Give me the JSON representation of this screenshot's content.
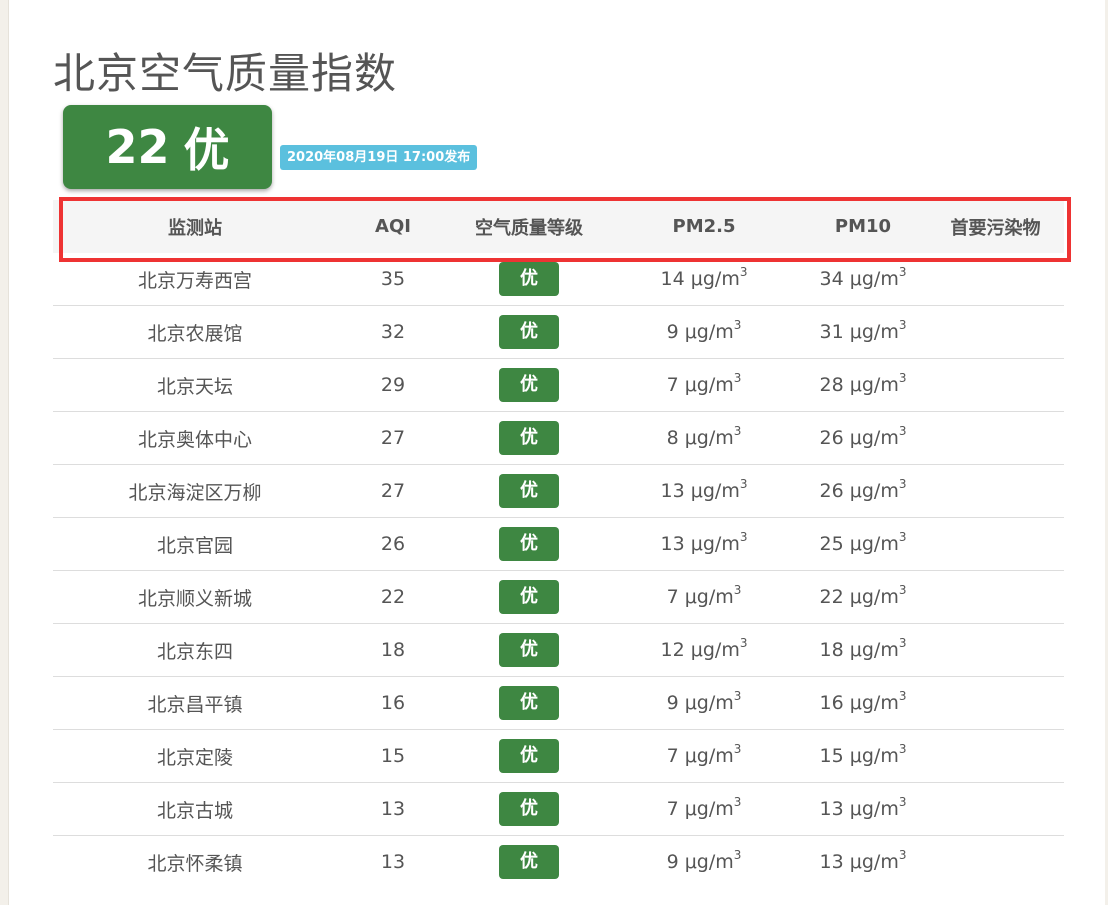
{
  "header": {
    "title": "北京空气质量指数",
    "aqi_value": "22",
    "aqi_level": "优",
    "publish_time": "2020年08月19日 17:00发布"
  },
  "table": {
    "columns": [
      "监测站",
      "AQI",
      "空气质量等级",
      "PM2.5",
      "PM10",
      "首要污染物"
    ],
    "unit_base": "μg/m",
    "unit_exp": "3",
    "rows": [
      {
        "station": "北京万寿西宫",
        "aqi": "35",
        "level": "优",
        "pm25": "14",
        "pm10": "34",
        "primary": ""
      },
      {
        "station": "北京农展馆",
        "aqi": "32",
        "level": "优",
        "pm25": "9",
        "pm10": "31",
        "primary": ""
      },
      {
        "station": "北京天坛",
        "aqi": "29",
        "level": "优",
        "pm25": "7",
        "pm10": "28",
        "primary": ""
      },
      {
        "station": "北京奥体中心",
        "aqi": "27",
        "level": "优",
        "pm25": "8",
        "pm10": "26",
        "primary": ""
      },
      {
        "station": "北京海淀区万柳",
        "aqi": "27",
        "level": "优",
        "pm25": "13",
        "pm10": "26",
        "primary": ""
      },
      {
        "station": "北京官园",
        "aqi": "26",
        "level": "优",
        "pm25": "13",
        "pm10": "25",
        "primary": ""
      },
      {
        "station": "北京顺义新城",
        "aqi": "22",
        "level": "优",
        "pm25": "7",
        "pm10": "22",
        "primary": ""
      },
      {
        "station": "北京东四",
        "aqi": "18",
        "level": "优",
        "pm25": "12",
        "pm10": "18",
        "primary": ""
      },
      {
        "station": "北京昌平镇",
        "aqi": "16",
        "level": "优",
        "pm25": "9",
        "pm10": "16",
        "primary": ""
      },
      {
        "station": "北京定陵",
        "aqi": "15",
        "level": "优",
        "pm25": "7",
        "pm10": "15",
        "primary": ""
      },
      {
        "station": "北京古城",
        "aqi": "13",
        "level": "优",
        "pm25": "7",
        "pm10": "13",
        "primary": ""
      },
      {
        "station": "北京怀柔镇",
        "aqi": "13",
        "level": "优",
        "pm25": "9",
        "pm10": "13",
        "primary": ""
      }
    ]
  },
  "colors": {
    "good_green": "#3e8742",
    "info_blue": "#5bc0de",
    "highlight_red": "#ee3333"
  }
}
